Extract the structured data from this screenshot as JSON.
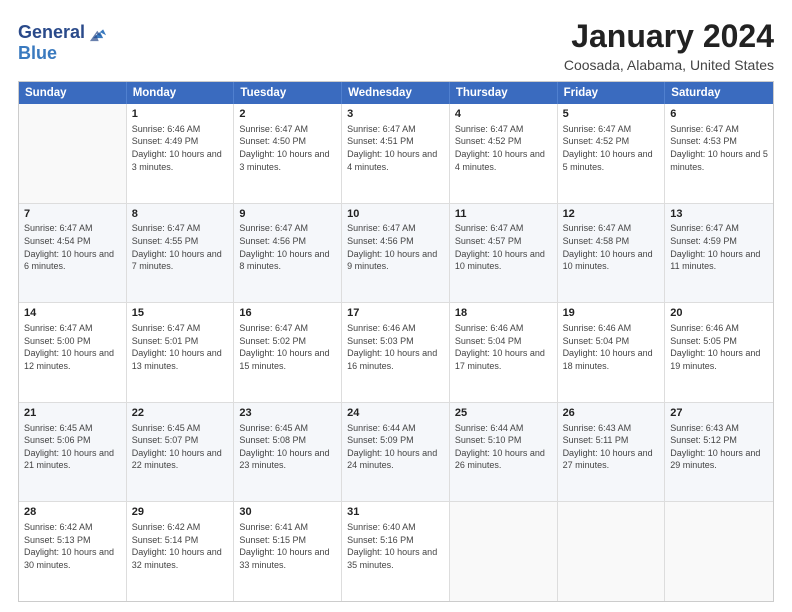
{
  "header": {
    "logo_line1": "General",
    "logo_line2": "Blue",
    "title": "January 2024",
    "subtitle": "Coosada, Alabama, United States"
  },
  "calendar": {
    "days_of_week": [
      "Sunday",
      "Monday",
      "Tuesday",
      "Wednesday",
      "Thursday",
      "Friday",
      "Saturday"
    ],
    "rows": [
      [
        {
          "num": "",
          "empty": true
        },
        {
          "num": "1",
          "rise": "Sunrise: 6:46 AM",
          "set": "Sunset: 4:49 PM",
          "day": "Daylight: 10 hours and 3 minutes."
        },
        {
          "num": "2",
          "rise": "Sunrise: 6:47 AM",
          "set": "Sunset: 4:50 PM",
          "day": "Daylight: 10 hours and 3 minutes."
        },
        {
          "num": "3",
          "rise": "Sunrise: 6:47 AM",
          "set": "Sunset: 4:51 PM",
          "day": "Daylight: 10 hours and 4 minutes."
        },
        {
          "num": "4",
          "rise": "Sunrise: 6:47 AM",
          "set": "Sunset: 4:52 PM",
          "day": "Daylight: 10 hours and 4 minutes."
        },
        {
          "num": "5",
          "rise": "Sunrise: 6:47 AM",
          "set": "Sunset: 4:52 PM",
          "day": "Daylight: 10 hours and 5 minutes."
        },
        {
          "num": "6",
          "rise": "Sunrise: 6:47 AM",
          "set": "Sunset: 4:53 PM",
          "day": "Daylight: 10 hours and 5 minutes."
        }
      ],
      [
        {
          "num": "7",
          "rise": "Sunrise: 6:47 AM",
          "set": "Sunset: 4:54 PM",
          "day": "Daylight: 10 hours and 6 minutes."
        },
        {
          "num": "8",
          "rise": "Sunrise: 6:47 AM",
          "set": "Sunset: 4:55 PM",
          "day": "Daylight: 10 hours and 7 minutes."
        },
        {
          "num": "9",
          "rise": "Sunrise: 6:47 AM",
          "set": "Sunset: 4:56 PM",
          "day": "Daylight: 10 hours and 8 minutes."
        },
        {
          "num": "10",
          "rise": "Sunrise: 6:47 AM",
          "set": "Sunset: 4:56 PM",
          "day": "Daylight: 10 hours and 9 minutes."
        },
        {
          "num": "11",
          "rise": "Sunrise: 6:47 AM",
          "set": "Sunset: 4:57 PM",
          "day": "Daylight: 10 hours and 10 minutes."
        },
        {
          "num": "12",
          "rise": "Sunrise: 6:47 AM",
          "set": "Sunset: 4:58 PM",
          "day": "Daylight: 10 hours and 10 minutes."
        },
        {
          "num": "13",
          "rise": "Sunrise: 6:47 AM",
          "set": "Sunset: 4:59 PM",
          "day": "Daylight: 10 hours and 11 minutes."
        }
      ],
      [
        {
          "num": "14",
          "rise": "Sunrise: 6:47 AM",
          "set": "Sunset: 5:00 PM",
          "day": "Daylight: 10 hours and 12 minutes."
        },
        {
          "num": "15",
          "rise": "Sunrise: 6:47 AM",
          "set": "Sunset: 5:01 PM",
          "day": "Daylight: 10 hours and 13 minutes."
        },
        {
          "num": "16",
          "rise": "Sunrise: 6:47 AM",
          "set": "Sunset: 5:02 PM",
          "day": "Daylight: 10 hours and 15 minutes."
        },
        {
          "num": "17",
          "rise": "Sunrise: 6:46 AM",
          "set": "Sunset: 5:03 PM",
          "day": "Daylight: 10 hours and 16 minutes."
        },
        {
          "num": "18",
          "rise": "Sunrise: 6:46 AM",
          "set": "Sunset: 5:04 PM",
          "day": "Daylight: 10 hours and 17 minutes."
        },
        {
          "num": "19",
          "rise": "Sunrise: 6:46 AM",
          "set": "Sunset: 5:04 PM",
          "day": "Daylight: 10 hours and 18 minutes."
        },
        {
          "num": "20",
          "rise": "Sunrise: 6:46 AM",
          "set": "Sunset: 5:05 PM",
          "day": "Daylight: 10 hours and 19 minutes."
        }
      ],
      [
        {
          "num": "21",
          "rise": "Sunrise: 6:45 AM",
          "set": "Sunset: 5:06 PM",
          "day": "Daylight: 10 hours and 21 minutes."
        },
        {
          "num": "22",
          "rise": "Sunrise: 6:45 AM",
          "set": "Sunset: 5:07 PM",
          "day": "Daylight: 10 hours and 22 minutes."
        },
        {
          "num": "23",
          "rise": "Sunrise: 6:45 AM",
          "set": "Sunset: 5:08 PM",
          "day": "Daylight: 10 hours and 23 minutes."
        },
        {
          "num": "24",
          "rise": "Sunrise: 6:44 AM",
          "set": "Sunset: 5:09 PM",
          "day": "Daylight: 10 hours and 24 minutes."
        },
        {
          "num": "25",
          "rise": "Sunrise: 6:44 AM",
          "set": "Sunset: 5:10 PM",
          "day": "Daylight: 10 hours and 26 minutes."
        },
        {
          "num": "26",
          "rise": "Sunrise: 6:43 AM",
          "set": "Sunset: 5:11 PM",
          "day": "Daylight: 10 hours and 27 minutes."
        },
        {
          "num": "27",
          "rise": "Sunrise: 6:43 AM",
          "set": "Sunset: 5:12 PM",
          "day": "Daylight: 10 hours and 29 minutes."
        }
      ],
      [
        {
          "num": "28",
          "rise": "Sunrise: 6:42 AM",
          "set": "Sunset: 5:13 PM",
          "day": "Daylight: 10 hours and 30 minutes."
        },
        {
          "num": "29",
          "rise": "Sunrise: 6:42 AM",
          "set": "Sunset: 5:14 PM",
          "day": "Daylight: 10 hours and 32 minutes."
        },
        {
          "num": "30",
          "rise": "Sunrise: 6:41 AM",
          "set": "Sunset: 5:15 PM",
          "day": "Daylight: 10 hours and 33 minutes."
        },
        {
          "num": "31",
          "rise": "Sunrise: 6:40 AM",
          "set": "Sunset: 5:16 PM",
          "day": "Daylight: 10 hours and 35 minutes."
        },
        {
          "num": "",
          "empty": true
        },
        {
          "num": "",
          "empty": true
        },
        {
          "num": "",
          "empty": true
        }
      ]
    ]
  }
}
